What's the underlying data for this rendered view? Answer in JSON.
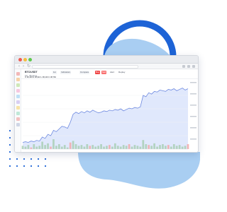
{
  "toolbar": {
    "symbol": "BTC/USDT",
    "exchange": "1D · Binance",
    "buttons": [
      "1m",
      "Indicators",
      "Compare",
      "Buy",
      "Sell",
      "Alert",
      "Replay"
    ],
    "legend": "O 38,420 H 38,910 L 38,100 C 38,760"
  },
  "colors": {
    "accent": "#1d63d6",
    "line": "#6d89e0",
    "fill": "#dbe4fb",
    "volume": "#a6cdb0"
  },
  "chart_data": {
    "type": "area",
    "title": "",
    "xlabel": "",
    "ylabel": "",
    "x": [
      0,
      1,
      2,
      3,
      4,
      5,
      6,
      7,
      8,
      9,
      10,
      11,
      12,
      13,
      14,
      15,
      16,
      17,
      18,
      19,
      20,
      21,
      22,
      23,
      24,
      25,
      26,
      27,
      28,
      29,
      30,
      31,
      32,
      33,
      34,
      35,
      36,
      37,
      38,
      39,
      40,
      41,
      42,
      43,
      44,
      45,
      46,
      47,
      48,
      49,
      50,
      51,
      52,
      53,
      54,
      55,
      56,
      57,
      58,
      59
    ],
    "values": [
      10,
      11,
      10,
      12,
      11,
      13,
      12,
      18,
      16,
      22,
      20,
      28,
      26,
      30,
      34,
      33,
      31,
      40,
      52,
      55,
      53,
      56,
      54,
      57,
      55,
      58,
      56,
      54,
      55,
      57,
      56,
      58,
      57,
      59,
      58,
      60,
      57,
      59,
      61,
      60,
      62,
      61,
      63,
      80,
      78,
      84,
      82,
      86,
      85,
      88,
      87,
      86,
      89,
      88,
      90,
      87,
      89,
      91,
      88,
      90
    ],
    "volume": [
      4,
      3,
      5,
      2,
      6,
      3,
      4,
      9,
      5,
      7,
      3,
      12,
      4,
      6,
      3,
      5,
      2,
      8,
      10,
      6,
      4,
      5,
      3,
      6,
      4,
      5,
      3,
      4,
      6,
      3,
      4,
      5,
      3,
      7,
      4,
      3,
      5,
      4,
      6,
      3,
      5,
      4,
      3,
      11,
      6,
      5,
      4,
      7,
      3,
      5,
      6,
      4,
      5,
      3,
      6,
      4,
      5,
      3,
      4,
      6
    ],
    "ylim": [
      0,
      100
    ]
  }
}
